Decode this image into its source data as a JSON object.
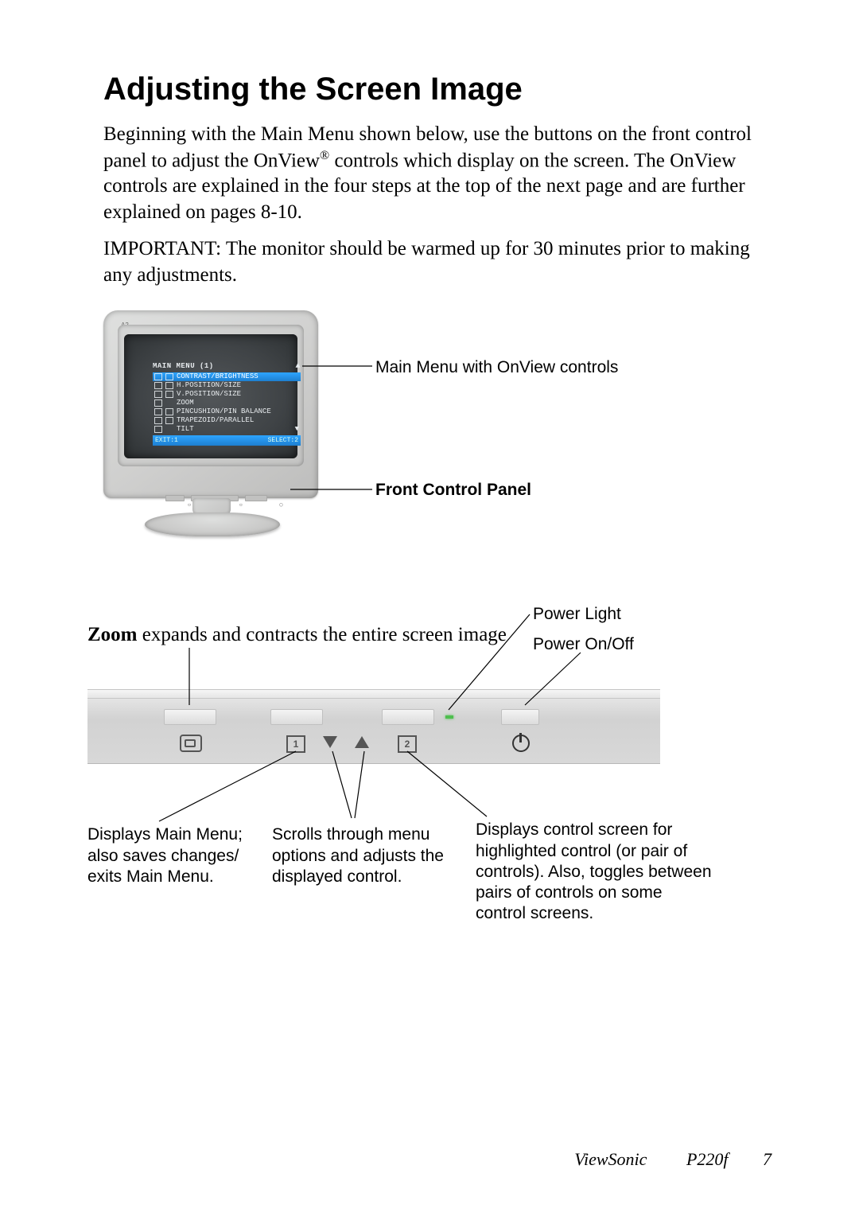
{
  "heading": "Adjusting the Screen Image",
  "para1_a": "Beginning with the Main Menu shown below, use the buttons on the front control panel to adjust the OnView",
  "para1_b": " controls which display on the screen. The OnView controls are explained in the four steps at the top of the next page and are further explained on pages 8-10.",
  "reg": "®",
  "para2": "IMPORTANT: The monitor should be warmed up for 30 minutes prior to making any adjustments.",
  "fig1": {
    "menu_title": "MAIN MENU (1)",
    "items": [
      "CONTRAST/BRIGHTNESS",
      "H.POSITION/SIZE",
      "V.POSITION/SIZE",
      "ZOOM",
      "PINCUSHION/PIN BALANCE",
      "TRAPEZOID/PARALLEL",
      "TILT"
    ],
    "footer_left": "EXIT:1",
    "footer_right": "SELECT:2",
    "callout_menu": "Main Menu with OnView controls",
    "callout_panel": "Front Control Panel"
  },
  "fig2": {
    "zoom_bold": "Zoom",
    "zoom_rest": " expands and contracts the entire screen image",
    "power_light": "Power Light",
    "power_onoff": "Power On/Off",
    "desc_left": "Displays Main Menu; also saves changes/ exits Main Menu.",
    "desc_mid": "Scrolls through menu options and adjusts the displayed control.",
    "desc_right": "Displays control screen for highlighted control (or pair of controls). Also, toggles between pairs of controls on some control screens."
  },
  "footer": {
    "brand": "ViewSonic",
    "model": "P220f",
    "page": "7"
  }
}
